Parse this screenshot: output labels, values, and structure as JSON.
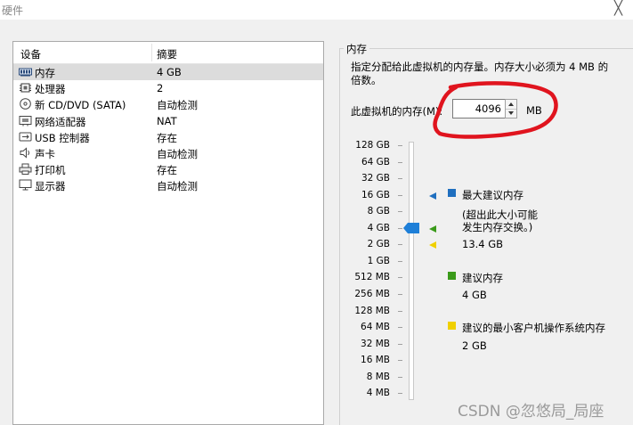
{
  "window": {
    "title": "硬件",
    "close_glyph": "╳"
  },
  "devices": {
    "col_device": "设备",
    "col_summary": "摘要",
    "rows": [
      {
        "icon": "memory-icon",
        "name": "内存",
        "summary": "4 GB",
        "selected": true
      },
      {
        "icon": "processor-icon",
        "name": "处理器",
        "summary": "2"
      },
      {
        "icon": "cd-dvd-icon",
        "name": "新 CD/DVD (SATA)",
        "summary": "自动检测"
      },
      {
        "icon": "network-adapter-icon",
        "name": "网络适配器",
        "summary": "NAT"
      },
      {
        "icon": "usb-icon",
        "name": "USB 控制器",
        "summary": "存在"
      },
      {
        "icon": "sound-card-icon",
        "name": "声卡",
        "summary": "自动检测"
      },
      {
        "icon": "printer-icon",
        "name": "打印机",
        "summary": "存在"
      },
      {
        "icon": "display-icon",
        "name": "显示器",
        "summary": "自动检测"
      }
    ]
  },
  "memory": {
    "group_title": "内存",
    "description": "指定分配给此虚拟机的内存量。内存大小必须为 4 MB 的倍数。",
    "field_label": "此虚拟机的内存(M):",
    "value": "4096",
    "unit": "MB",
    "scale": [
      "128 GB",
      "64 GB",
      "32 GB",
      "16 GB",
      "8 GB",
      "4 GB",
      "2 GB",
      "1 GB",
      "512 MB",
      "256 MB",
      "128 MB",
      "64 MB",
      "32 MB",
      "16 MB",
      "8 MB",
      "4 MB"
    ],
    "current_level": "4 GB",
    "legend": {
      "max": {
        "label": "最大建议内存",
        "note_line1": "(超出此大小可能",
        "note_line2": "发生内存交换。)",
        "value": "13.4 GB",
        "color": "#1f6fbf"
      },
      "recommended": {
        "label": "建议内存",
        "value": "4 GB",
        "color": "#3a9a1a"
      },
      "min_guest": {
        "label": "建议的最小客户机操作系统内存",
        "value": "2 GB",
        "color": "#f0d000"
      }
    }
  },
  "colors": {
    "thumb": "#1e7fd8",
    "annotation": "#e0141e"
  },
  "watermark": "CSDN @忽悠局_局座"
}
